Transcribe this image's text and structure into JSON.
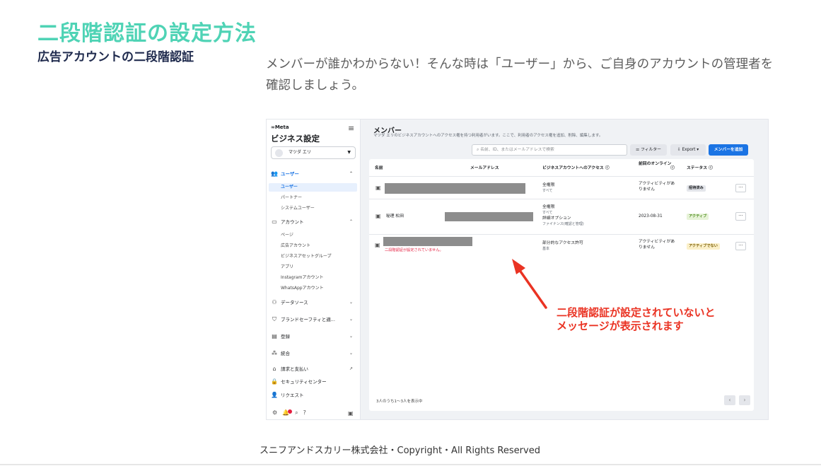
{
  "slide": {
    "title": "二段階認証の設定方法",
    "subtitle": "広告アカウントの二段階認証",
    "description": "メンバーが誰かわからない！そんな時は「ユーザー」から、ご自身のアカウントの管理者を確認しましょう。",
    "footer": "スニフアンドスカリー株式会社・Copyright・All Rights Reserved"
  },
  "screenshot": {
    "sidebar": {
      "logo": "∞Meta",
      "title": "ビジネス設定",
      "account": "マツダ エリ",
      "users_group": "ユーザー",
      "users_items": [
        "ユーザー",
        "パートナー",
        "システムユーザー"
      ],
      "accounts_group": "アカウント",
      "accounts_items": [
        "ページ",
        "広告アカウント",
        "ビジネスアセットグループ",
        "アプリ",
        "Instagramアカウント",
        "WhatsAppアカウント"
      ],
      "data_sources": "データソース",
      "brand_safety": "ブランドセーフティと適...",
      "registration": "登録",
      "integration": "統合",
      "billing": "請求と支払い",
      "security_center": "セキュリティセンター",
      "requests": "リクエスト"
    },
    "header": {
      "title": "メンバー",
      "subtitle": "マツダ エリのビジネスアカウントへのアクセス権を持つ利用者がいます。ここで、利用者のアクセス権を追加、削除、編集します。",
      "search_placeholder": "名前、ID、またはメールアドレスで検索",
      "filter_label": "フィルター",
      "export_label": "Export",
      "add_member_label": "メンバーを追加"
    },
    "table": {
      "columns": [
        "名前",
        "メールアドレス",
        "ビジネスアカウントへのアクセス",
        "前回のオンライン",
        "ステータス"
      ],
      "rows": [
        {
          "name": "",
          "access": "全権限",
          "access_sub": "すべて",
          "access_extra": "",
          "access_extra_sub": "",
          "last_online": "アクティビティがありません",
          "status": "招待済み",
          "warning": ""
        },
        {
          "name": "秘理 松田",
          "access": "全権限",
          "access_sub": "すべて",
          "access_extra": "詳細オプション",
          "access_extra_sub": "ファイナンス(確認と管理)",
          "last_online": "2023-08-31",
          "status": "アクティブ",
          "warning": ""
        },
        {
          "name": "",
          "access": "部分的なアクセス許可",
          "access_sub": "基本",
          "access_extra": "",
          "access_extra_sub": "",
          "last_online": "アクティビティがありません",
          "status": "アクティブでない",
          "warning": "二段階認証が設定されていません。"
        }
      ],
      "footer": "3人のうち1〜3人を表示中"
    },
    "annotation": "二段階認証が設定されていないとメッセージが表示されます",
    "annotation_line1": "二段階認証が設定されていないと",
    "annotation_line2": "メッセージが表示されます"
  },
  "colors": {
    "title": "#4fd3b5",
    "subtitle": "#1f2a4d",
    "annotation": "#ea3323",
    "accent": "#1b74e4"
  }
}
